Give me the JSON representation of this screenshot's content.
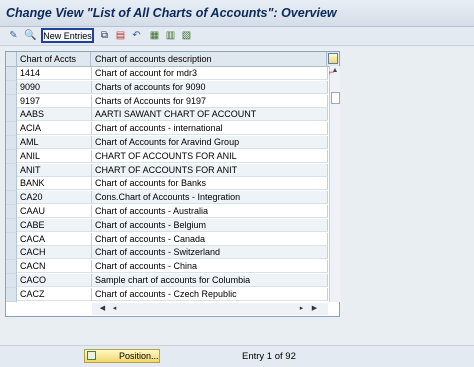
{
  "window": {
    "title": "Change View \"List of All Charts of Accounts\": Overview"
  },
  "toolbar": {
    "new_entries_label": "New Entries",
    "icons": [
      "display-change-icon",
      "details-icon",
      "copy-icon",
      "delete-icon",
      "undo-icon",
      "select-all-icon",
      "select-block-icon",
      "deselect-all-icon"
    ]
  },
  "table": {
    "columns": [
      "Chart of Accts",
      "Chart of accounts description"
    ],
    "rows": [
      [
        "1414",
        "Chart of account for mdr3"
      ],
      [
        "9090",
        "Charts of accounts  for 9090"
      ],
      [
        "9197",
        "Charts of Accounts for 9197"
      ],
      [
        "AABS",
        "AARTI SAWANT CHART OF ACCOUNT"
      ],
      [
        "ACIA",
        "Chart of accounts - international"
      ],
      [
        "AML",
        "Chart of Accounts for Aravind Group"
      ],
      [
        "ANIL",
        "CHART OF ACCOUNTS FOR ANIL"
      ],
      [
        "ANIT",
        "CHART OF ACCOUNTS FOR ANIT"
      ],
      [
        "BANK",
        "Chart of accounts for Banks"
      ],
      [
        "CA20",
        "Cons.Chart of Accounts - Integration"
      ],
      [
        "CAAU",
        "Chart of accounts - Australia"
      ],
      [
        "CABE",
        "Chart of accounts - Belgium"
      ],
      [
        "CACA",
        "Chart of accounts - Canada"
      ],
      [
        "CACH",
        "Chart of accounts - Switzerland"
      ],
      [
        "CACN",
        "Chart of accounts - China"
      ],
      [
        "CACO",
        "Sample chart of accounts for Columbia"
      ],
      [
        "CACZ",
        "Chart of accounts - Czech Republic"
      ]
    ]
  },
  "footer": {
    "position_label": "Position...",
    "entry_info": "Entry 1 of 92"
  },
  "colors": {
    "accent": "#1f3f9a",
    "header_bg": "#dfe7ef",
    "button_yellow": "#f1d86a"
  }
}
